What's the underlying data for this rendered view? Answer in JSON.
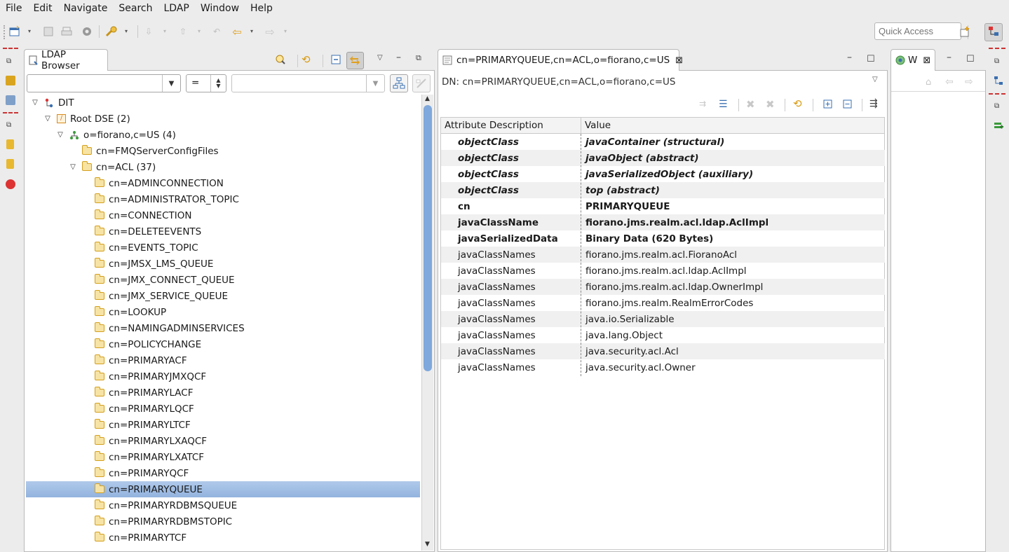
{
  "menu": [
    "File",
    "Edit",
    "Navigate",
    "Search",
    "LDAP",
    "Window",
    "Help"
  ],
  "quick_access_placeholder": "Quick Access",
  "browser": {
    "title": "LDAP Browser",
    "filter_operator": "=",
    "tree": [
      {
        "label": "DIT",
        "depth": 0,
        "expanded": true,
        "icon": "dit-icon"
      },
      {
        "label": "Root DSE (2)",
        "depth": 1,
        "expanded": true,
        "icon": "root-dse-icon"
      },
      {
        "label": "o=fiorano,c=US (4)",
        "depth": 2,
        "expanded": true,
        "icon": "organization-icon"
      },
      {
        "label": "cn=FMQServerConfigFiles",
        "depth": 3,
        "icon": "folder-icon"
      },
      {
        "label": "cn=ACL (37)",
        "depth": 3,
        "expanded": true,
        "icon": "folder-icon"
      },
      {
        "label": "cn=ADMINCONNECTION",
        "depth": 4,
        "icon": "folder-icon"
      },
      {
        "label": "cn=ADMINISTRATOR_TOPIC",
        "depth": 4,
        "icon": "folder-icon"
      },
      {
        "label": "cn=CONNECTION",
        "depth": 4,
        "icon": "folder-icon"
      },
      {
        "label": "cn=DELETEEVENTS",
        "depth": 4,
        "icon": "folder-icon"
      },
      {
        "label": "cn=EVENTS_TOPIC",
        "depth": 4,
        "icon": "folder-icon"
      },
      {
        "label": "cn=JMSX_LMS_QUEUE",
        "depth": 4,
        "icon": "folder-icon"
      },
      {
        "label": "cn=JMX_CONNECT_QUEUE",
        "depth": 4,
        "icon": "folder-icon"
      },
      {
        "label": "cn=JMX_SERVICE_QUEUE",
        "depth": 4,
        "icon": "folder-icon"
      },
      {
        "label": "cn=LOOKUP",
        "depth": 4,
        "icon": "folder-icon"
      },
      {
        "label": "cn=NAMINGADMINSERVICES",
        "depth": 4,
        "icon": "folder-icon"
      },
      {
        "label": "cn=POLICYCHANGE",
        "depth": 4,
        "icon": "folder-icon"
      },
      {
        "label": "cn=PRIMARYACF",
        "depth": 4,
        "icon": "folder-icon"
      },
      {
        "label": "cn=PRIMARYJMXQCF",
        "depth": 4,
        "icon": "folder-icon"
      },
      {
        "label": "cn=PRIMARYLACF",
        "depth": 4,
        "icon": "folder-icon"
      },
      {
        "label": "cn=PRIMARYLQCF",
        "depth": 4,
        "icon": "folder-icon"
      },
      {
        "label": "cn=PRIMARYLTCF",
        "depth": 4,
        "icon": "folder-icon"
      },
      {
        "label": "cn=PRIMARYLXAQCF",
        "depth": 4,
        "icon": "folder-icon"
      },
      {
        "label": "cn=PRIMARYLXATCF",
        "depth": 4,
        "icon": "folder-icon"
      },
      {
        "label": "cn=PRIMARYQCF",
        "depth": 4,
        "icon": "folder-icon"
      },
      {
        "label": "cn=PRIMARYQUEUE",
        "depth": 4,
        "icon": "folder-icon",
        "selected": true
      },
      {
        "label": "cn=PRIMARYRDBMSQUEUE",
        "depth": 4,
        "icon": "folder-icon"
      },
      {
        "label": "cn=PRIMARYRDBMSTOPIC",
        "depth": 4,
        "icon": "folder-icon"
      },
      {
        "label": "cn=PRIMARYTCF",
        "depth": 4,
        "icon": "folder-icon"
      }
    ]
  },
  "editor": {
    "tab_title": "cn=PRIMARYQUEUE,cn=ACL,o=fiorano,c=US",
    "dn_text": "DN: cn=PRIMARYQUEUE,cn=ACL,o=fiorano,c=US",
    "columns": [
      "Attribute Description",
      "Value"
    ],
    "rows": [
      {
        "attr": "objectClass",
        "value": "javaContainer (structural)",
        "style": "bolditalic"
      },
      {
        "attr": "objectClass",
        "value": "javaObject (abstract)",
        "style": "bolditalic"
      },
      {
        "attr": "objectClass",
        "value": "javaSerializedObject (auxiliary)",
        "style": "bolditalic"
      },
      {
        "attr": "objectClass",
        "value": "top (abstract)",
        "style": "bolditalic"
      },
      {
        "attr": "cn",
        "value": "PRIMARYQUEUE",
        "style": "bold"
      },
      {
        "attr": "javaClassName",
        "value": "fiorano.jms.realm.acl.ldap.AclImpl",
        "style": "bold"
      },
      {
        "attr": "javaSerializedData",
        "value": "Binary Data (620 Bytes)",
        "style": "bold"
      },
      {
        "attr": "javaClassNames",
        "value": "fiorano.jms.realm.acl.FioranoAcl",
        "style": "normal"
      },
      {
        "attr": "javaClassNames",
        "value": "fiorano.jms.realm.acl.ldap.AclImpl",
        "style": "normal"
      },
      {
        "attr": "javaClassNames",
        "value": "fiorano.jms.realm.acl.ldap.OwnerImpl",
        "style": "normal"
      },
      {
        "attr": "javaClassNames",
        "value": "fiorano.jms.realm.RealmErrorCodes",
        "style": "normal"
      },
      {
        "attr": "javaClassNames",
        "value": "java.io.Serializable",
        "style": "normal"
      },
      {
        "attr": "javaClassNames",
        "value": "java.lang.Object",
        "style": "normal"
      },
      {
        "attr": "javaClassNames",
        "value": "java.security.acl.Acl",
        "style": "normal"
      },
      {
        "attr": "javaClassNames",
        "value": "java.security.acl.Owner",
        "style": "normal"
      }
    ]
  },
  "welcome": {
    "tab_title": "W"
  },
  "colors": {
    "selection": "#a6c3e8",
    "scroll_thumb": "#7fa8dc",
    "alt_row": "#f0f0f0"
  }
}
